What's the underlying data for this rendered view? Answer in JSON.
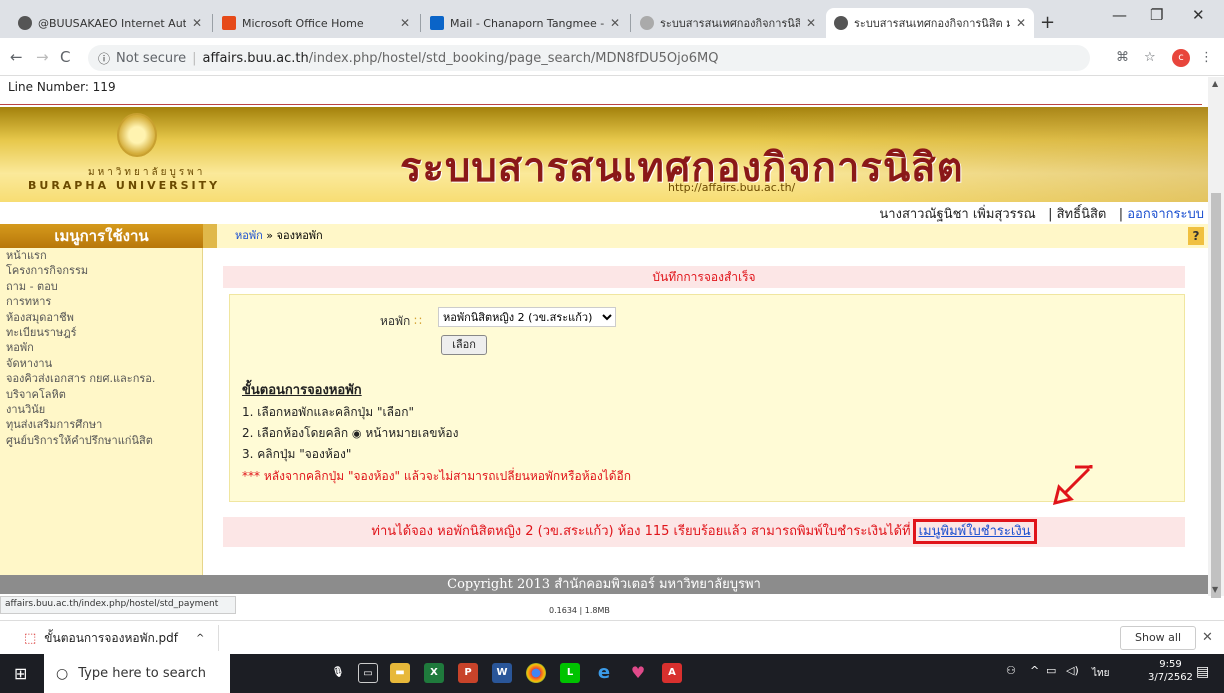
{
  "browser": {
    "tabs": [
      {
        "label": "@BUUSAKAEO Internet Authen",
        "color": "#555"
      },
      {
        "label": "Microsoft Office Home",
        "color": "#e64a19"
      },
      {
        "label": "Mail - Chanaporn Tangmee - O",
        "color": "#0a64c8"
      },
      {
        "label": "ระบบสารสนเทศกองกิจการนิสิต มหา",
        "color": "#888"
      },
      {
        "label": "ระบบสารสนเทศกองกิจการนิสิต มหา",
        "color": "#555"
      }
    ],
    "not_secure": "Not secure",
    "url_host": "affairs.buu.ac.th",
    "url_path": "/index.php/hostel/std_booking/page_search/MDN8fDU5Ojo6MQ",
    "profile_initial": "c"
  },
  "page": {
    "line_number": "Line Number: 119",
    "banner": {
      "univ_th": "มหาวิทยาลัยบูรพา",
      "univ_en": "BURAPHA UNIVERSITY",
      "title": "ระบบสารสนเทศกองกิจการนิสิต",
      "url": "http://affairs.buu.ac.th/"
    },
    "user": {
      "name": "นางสาวณัฐนิชา เพิ่มสุวรรณ",
      "role": "สิทธิ์นิสิต",
      "logout": "ออกจากระบบ"
    },
    "sidebar": {
      "heading": "เมนูการใช้งาน",
      "items": [
        "หน้าแรก",
        "โครงการกิจกรรม",
        "ถาม - ตอบ",
        "การทหาร",
        "ห้องสมุดอาชีพ",
        "ทะเบียนราษฎร์",
        "หอพัก",
        "จัดหางาน",
        "จองคิวส่งเอกสาร กยศ.และกรอ.",
        "บริจาคโลหิต",
        "งานวินัย",
        "ทุนส่งเสริมการศึกษา",
        "ศูนย์บริการให้คำปรึกษาแก่นิสิต"
      ]
    },
    "breadcrumb": {
      "link": "หอพัก",
      "sep": "»",
      "current": "จองหอพัก"
    },
    "help": "?",
    "notice": "บันทึกการจองสำเร็จ",
    "form": {
      "dorm_label": "หอพัก",
      "dorm_selected": "หอพักนิสิตหญิง 2 (วข.สระแก้ว)",
      "select_button": "เลือก",
      "steps_heading": "ขั้นตอนการจองหอพัก",
      "step1": "1. เลือกหอพักและคลิกปุ่ม \"เลือก\"",
      "step2_a": "2. เลือกห้องโดยคลิก",
      "step2_b": "หน้าหมายเลขห้อง",
      "step3": "3. คลิกปุ่ม \"จองห้อง\"",
      "warning": "*** หลังจากคลิกปุ่ม \"จองห้อง\" แล้วจะไม่สามารถเปลี่ยนหอพักหรือห้องได้อีก"
    },
    "result": {
      "text": "ท่านได้จอง หอพักนิสิตหญิง 2 (วข.สระแก้ว) ห้อง 115 เรียบร้อยแล้ว สามารถพิมพ์ใบชำระเงินได้ที่",
      "link": "เมนูพิมพ์ใบชำระเงิน"
    },
    "footer": "Copyright 2013    สำนักคอมพิวเตอร์ มหาวิทยาลัยบูรพา",
    "status_url": "affairs.buu.ac.th/index.php/hostel/std_payment",
    "mem_stat": "0.1634 | 1.8MB"
  },
  "downloads": {
    "file": "ขั้นตอนการจองหอพัก.pdf",
    "show_all": "Show all"
  },
  "taskbar": {
    "search_placeholder": "Type here to search",
    "lang": "ไทย",
    "time": "9:59",
    "date": "3/7/2562"
  }
}
